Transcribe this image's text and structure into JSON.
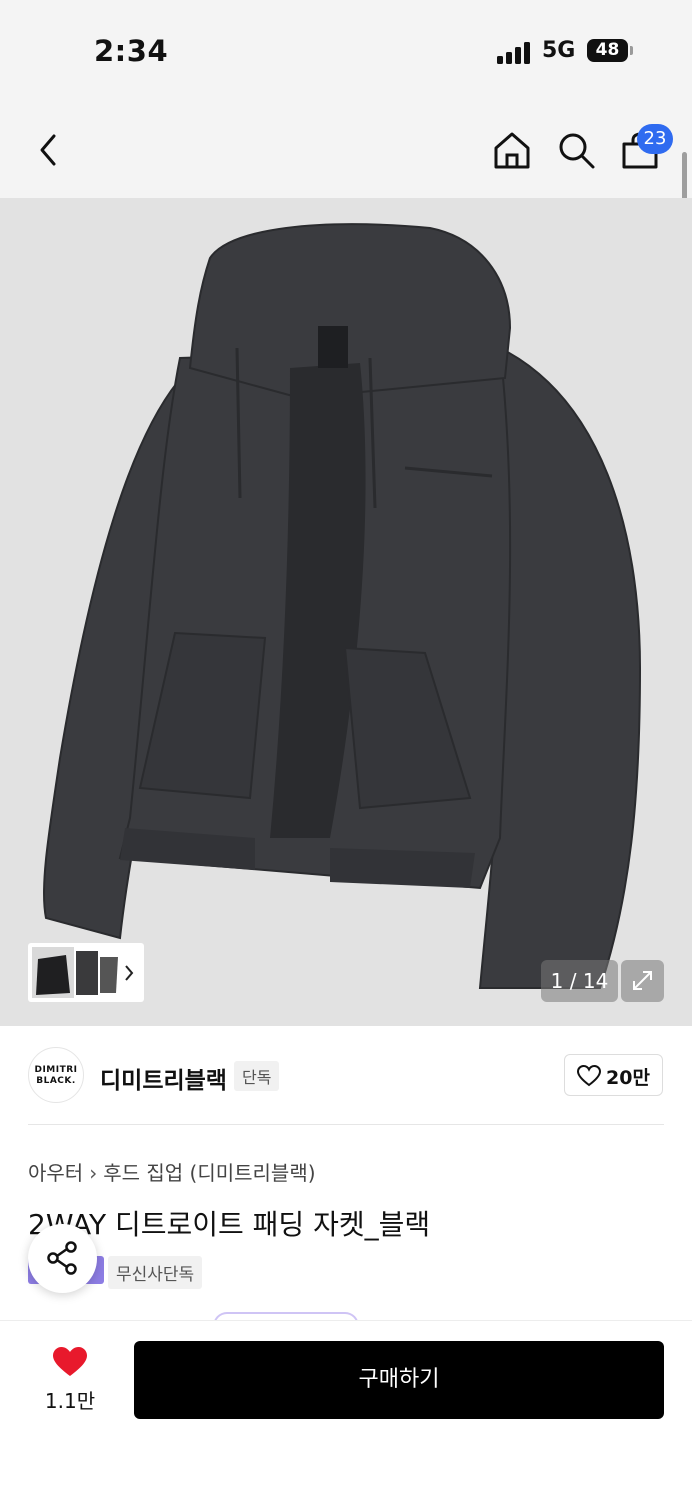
{
  "status_bar": {
    "time": "2:34",
    "network": "5G",
    "battery": "48"
  },
  "nav": {
    "cart_count": "23"
  },
  "gallery": {
    "counter": "1 / 14",
    "thumbnail_icon": "chevron-right-icon"
  },
  "brand": {
    "logo_text_line1": "DIMITRI",
    "logo_text_line2": "BLACK.",
    "name": "디미트리블랙",
    "tag": "단독",
    "likes": "20만"
  },
  "product": {
    "breadcrumb": [
      "아우터",
      "후드 집업 (디미트리블랙)"
    ],
    "title": "2WAY 디트로이트 패딩 자켓_블랙",
    "tag": "무신사단독"
  },
  "bottom_bar": {
    "wish_count": "1.1만",
    "buy_label": "구매하기"
  },
  "colors": {
    "accent_blue": "#2f6bf0",
    "heart_red": "#e8192c",
    "tag_purple": "#8d7de4",
    "buy_button": "#000000"
  }
}
